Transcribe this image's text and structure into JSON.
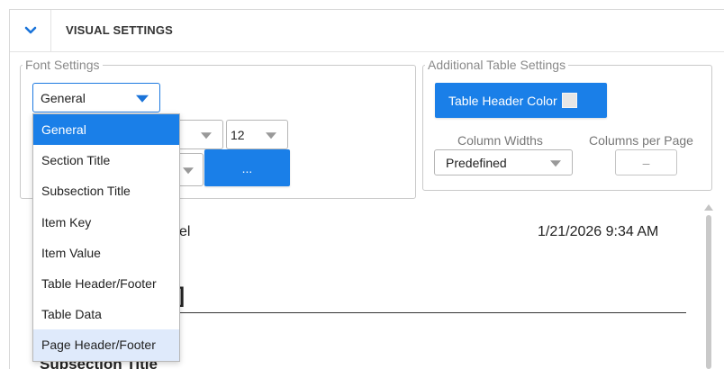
{
  "header": {
    "title": "VISUAL SETTINGS",
    "collapse_icon": "chevron-down-icon"
  },
  "font_settings": {
    "legend": "Font Settings",
    "font_type_select": {
      "value": "General"
    },
    "size_select": {
      "value": "12"
    },
    "color_button_label": "...",
    "dropdown_options": [
      "General",
      "Section Title",
      "Subsection Title",
      "Item Key",
      "Item Value",
      "Table Header/Footer",
      "Table Data",
      "Page Header/Footer"
    ],
    "selected_option": "General",
    "hovered_option": "Page Header/Footer"
  },
  "table_settings": {
    "legend": "Additional Table Settings",
    "header_color_button": "Table Header Color",
    "column_widths_label": "Column Widths",
    "column_widths_value": "Predefined",
    "columns_per_page_label": "Columns per Page",
    "columns_per_page_value": "–"
  },
  "preview": {
    "header_fragment": "el",
    "timestamp": "1/21/2026 9:34 AM",
    "bracket_fragment": "]",
    "subsection_title": "Subsection Title"
  },
  "colors": {
    "accent": "#1a7fe8",
    "hover": "#dfeafb",
    "header_color_swatch": "#e6e6e6"
  }
}
